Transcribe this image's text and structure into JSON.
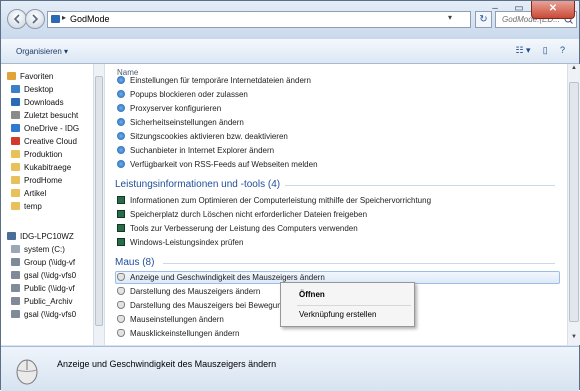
{
  "address": {
    "path": "GodMode",
    "search_placeholder": "GodMode.{ED..."
  },
  "toolbar": {
    "organize": "Organisieren ▾"
  },
  "nav": [
    {
      "label": "Favoriten",
      "color": "#e0a43a"
    },
    {
      "label": "Desktop",
      "color": "#3b7fc4"
    },
    {
      "label": "Downloads",
      "color": "#2b6bb5"
    },
    {
      "label": "Zuletzt besucht",
      "color": "#8b8b8b"
    },
    {
      "label": "OneDrive - IDG",
      "color": "#2f7ad0"
    },
    {
      "label": "Creative Cloud",
      "color": "#d33a2c"
    },
    {
      "label": "Produktion",
      "color": "#e8c15a"
    },
    {
      "label": "Kukabitraege",
      "color": "#e8c15a"
    },
    {
      "label": "ProdHome",
      "color": "#e8c15a"
    },
    {
      "label": "Artikel",
      "color": "#e8c15a"
    },
    {
      "label": "temp",
      "color": "#e8c15a"
    },
    {
      "label": "IDG-LPC10WZ",
      "color": "#4a6e98"
    },
    {
      "label": "system (C:)",
      "color": "#9aa7b6"
    },
    {
      "label": "Group (\\\\idg-vf",
      "color": "#7f8b98"
    },
    {
      "label": "gsal (\\\\idg-vfs0",
      "color": "#7f8b98"
    },
    {
      "label": "Public (\\\\idg-vf",
      "color": "#7f8b98"
    },
    {
      "label": "Public_Archiv",
      "color": "#7f8b98"
    },
    {
      "label": "gsal (\\\\idg-vfs0",
      "color": "#7f8b98"
    }
  ],
  "content": {
    "column_name": "Name",
    "ie_items": [
      "Einstellungen für temporäre Internetdateien ändern",
      "Popups blockieren oder zulassen",
      "Proxyserver konfigurieren",
      "Sicherheitseinstellungen ändern",
      "Sitzungscookies aktivieren bzw. deaktivieren",
      "Suchanbieter in Internet Explorer ändern",
      "Verfügbarkeit von RSS-Feeds auf Webseiten melden"
    ],
    "perf_group": "Leistungsinformationen und -tools (4)",
    "perf_items": [
      "Informationen zum Optimieren der Computerleistung mithilfe der Speichervorrichtung",
      "Speicherplatz durch Löschen nicht erforderlicher Dateien freigeben",
      "Tools zur Verbesserung der Leistung des Computers verwenden",
      "Windows-Leistungsindex prüfen"
    ],
    "mouse_group": "Maus (8)",
    "mouse_items": [
      "Anzeige und Geschwindigkeit des Mauszeigers ändern",
      "Darstellung des Mauszeigers ändern",
      "Darstellung des Mauszeigers bei Bewegung",
      "Mauseinstellungen ändern",
      "Mausklickeinstellungen ändern"
    ]
  },
  "context_menu": {
    "open": "Öffnen",
    "shortcut": "Verknüpfung erstellen"
  },
  "details": {
    "text": "Anzeige und Geschwindigkeit des Mauszeigers ändern"
  }
}
